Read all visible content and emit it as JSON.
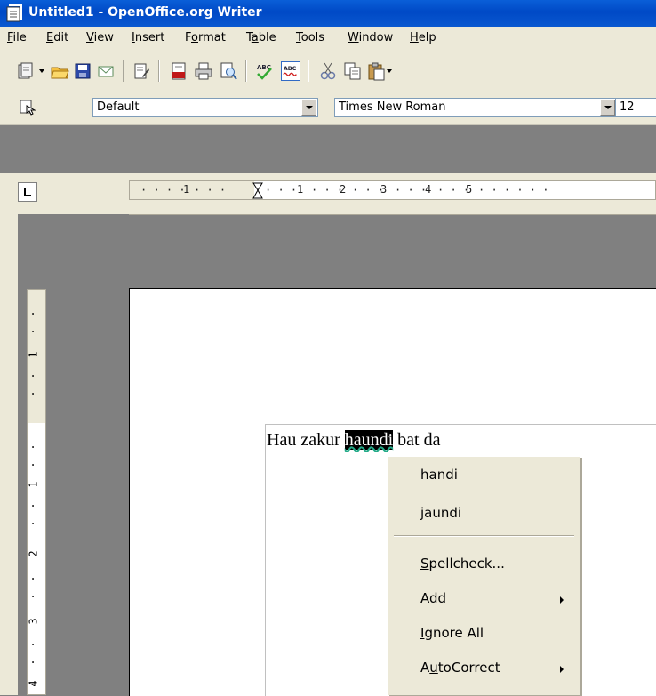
{
  "window": {
    "title": "Untitled1 - OpenOffice.org Writer"
  },
  "menubar": {
    "items": [
      {
        "pre": "",
        "u": "F",
        "post": "ile"
      },
      {
        "pre": "",
        "u": "E",
        "post": "dit"
      },
      {
        "pre": "",
        "u": "V",
        "post": "iew"
      },
      {
        "pre": "",
        "u": "I",
        "post": "nsert"
      },
      {
        "pre": "F",
        "u": "o",
        "post": "rmat"
      },
      {
        "pre": "T",
        "u": "a",
        "post": "ble"
      },
      {
        "pre": "",
        "u": "T",
        "post": "ools"
      },
      {
        "pre": "",
        "u": "W",
        "post": "indow"
      },
      {
        "pre": "",
        "u": "H",
        "post": "elp"
      }
    ]
  },
  "toolbar": {
    "icons": [
      "new-document-icon",
      "open-folder-icon",
      "save-icon",
      "email-icon",
      "edit-file-icon",
      "export-pdf-icon",
      "print-icon",
      "page-preview-icon",
      "spellcheck-icon",
      "autospellcheck-icon",
      "cut-icon",
      "copy-icon",
      "paste-icon"
    ]
  },
  "format_toolbar": {
    "style_value": "Default",
    "font_value": "Times New Roman",
    "size_value": "12"
  },
  "ruler": {
    "h_labels": [
      "1",
      "1",
      "2",
      "3",
      "4",
      "5"
    ],
    "v_labels": [
      "1",
      "1",
      "2",
      "3",
      "4"
    ]
  },
  "document": {
    "before": "Hau zakur ",
    "selected": "haundi",
    "after": " bat da"
  },
  "context_menu": {
    "suggestions": [
      "handi",
      "jaundi"
    ],
    "spellcheck": {
      "pre": "",
      "u": "S",
      "post": "pellcheck..."
    },
    "add": {
      "pre": "",
      "u": "A",
      "post": "dd"
    },
    "ignore_all": {
      "pre": "",
      "u": "I",
      "post": "gnore All"
    },
    "autocorrect": {
      "pre": "A",
      "u": "u",
      "post": "toCorrect"
    }
  }
}
